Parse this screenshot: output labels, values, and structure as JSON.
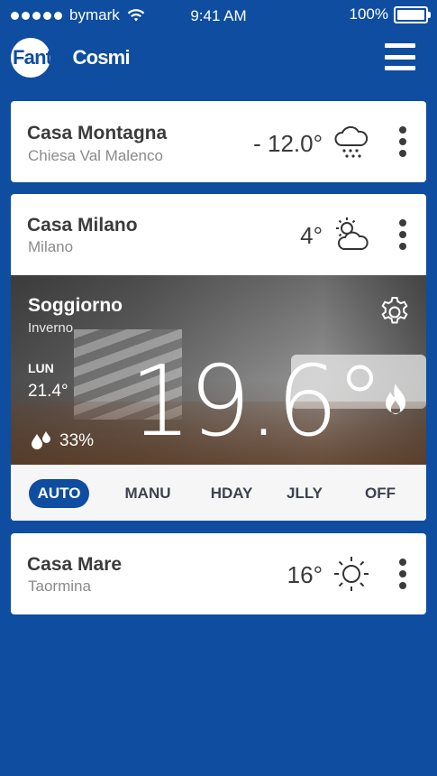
{
  "status_bar": {
    "carrier": "bymark",
    "time": "9:41 AM",
    "battery": "100%"
  },
  "header": {
    "logo_part1": "Fantini",
    "logo_part2": "Cosmi",
    "menu_icon": "hamburger-menu-icon"
  },
  "houses": [
    {
      "name": "Casa Montagna",
      "place": "Chiesa Val Malenco",
      "temperature": "- 12.0°",
      "weather_icon": "snow-cloud-icon"
    },
    {
      "name": "Casa Milano",
      "place": "Milano",
      "temperature": "4°",
      "weather_icon": "partly-cloudy-icon"
    },
    {
      "name": "Casa Mare",
      "place": "Taormina",
      "temperature": "16°",
      "weather_icon": "sun-icon"
    }
  ],
  "room": {
    "name": "Soggiorno",
    "season": "Inverno",
    "day": "LUN",
    "setpoint": "21.4°",
    "temperature": "19.6°",
    "humidity": "33%",
    "settings_icon": "gear-icon",
    "heating_icon": "flame-icon",
    "humidity_icon": "water-drops-icon"
  },
  "modes": {
    "selected": "AUTO",
    "items": [
      "AUTO",
      "MANU",
      "HDAY",
      "JLLY",
      "OFF"
    ]
  },
  "colors": {
    "background": "#0e4d9f",
    "accent": "#0e4d9f",
    "card": "#ffffff"
  }
}
